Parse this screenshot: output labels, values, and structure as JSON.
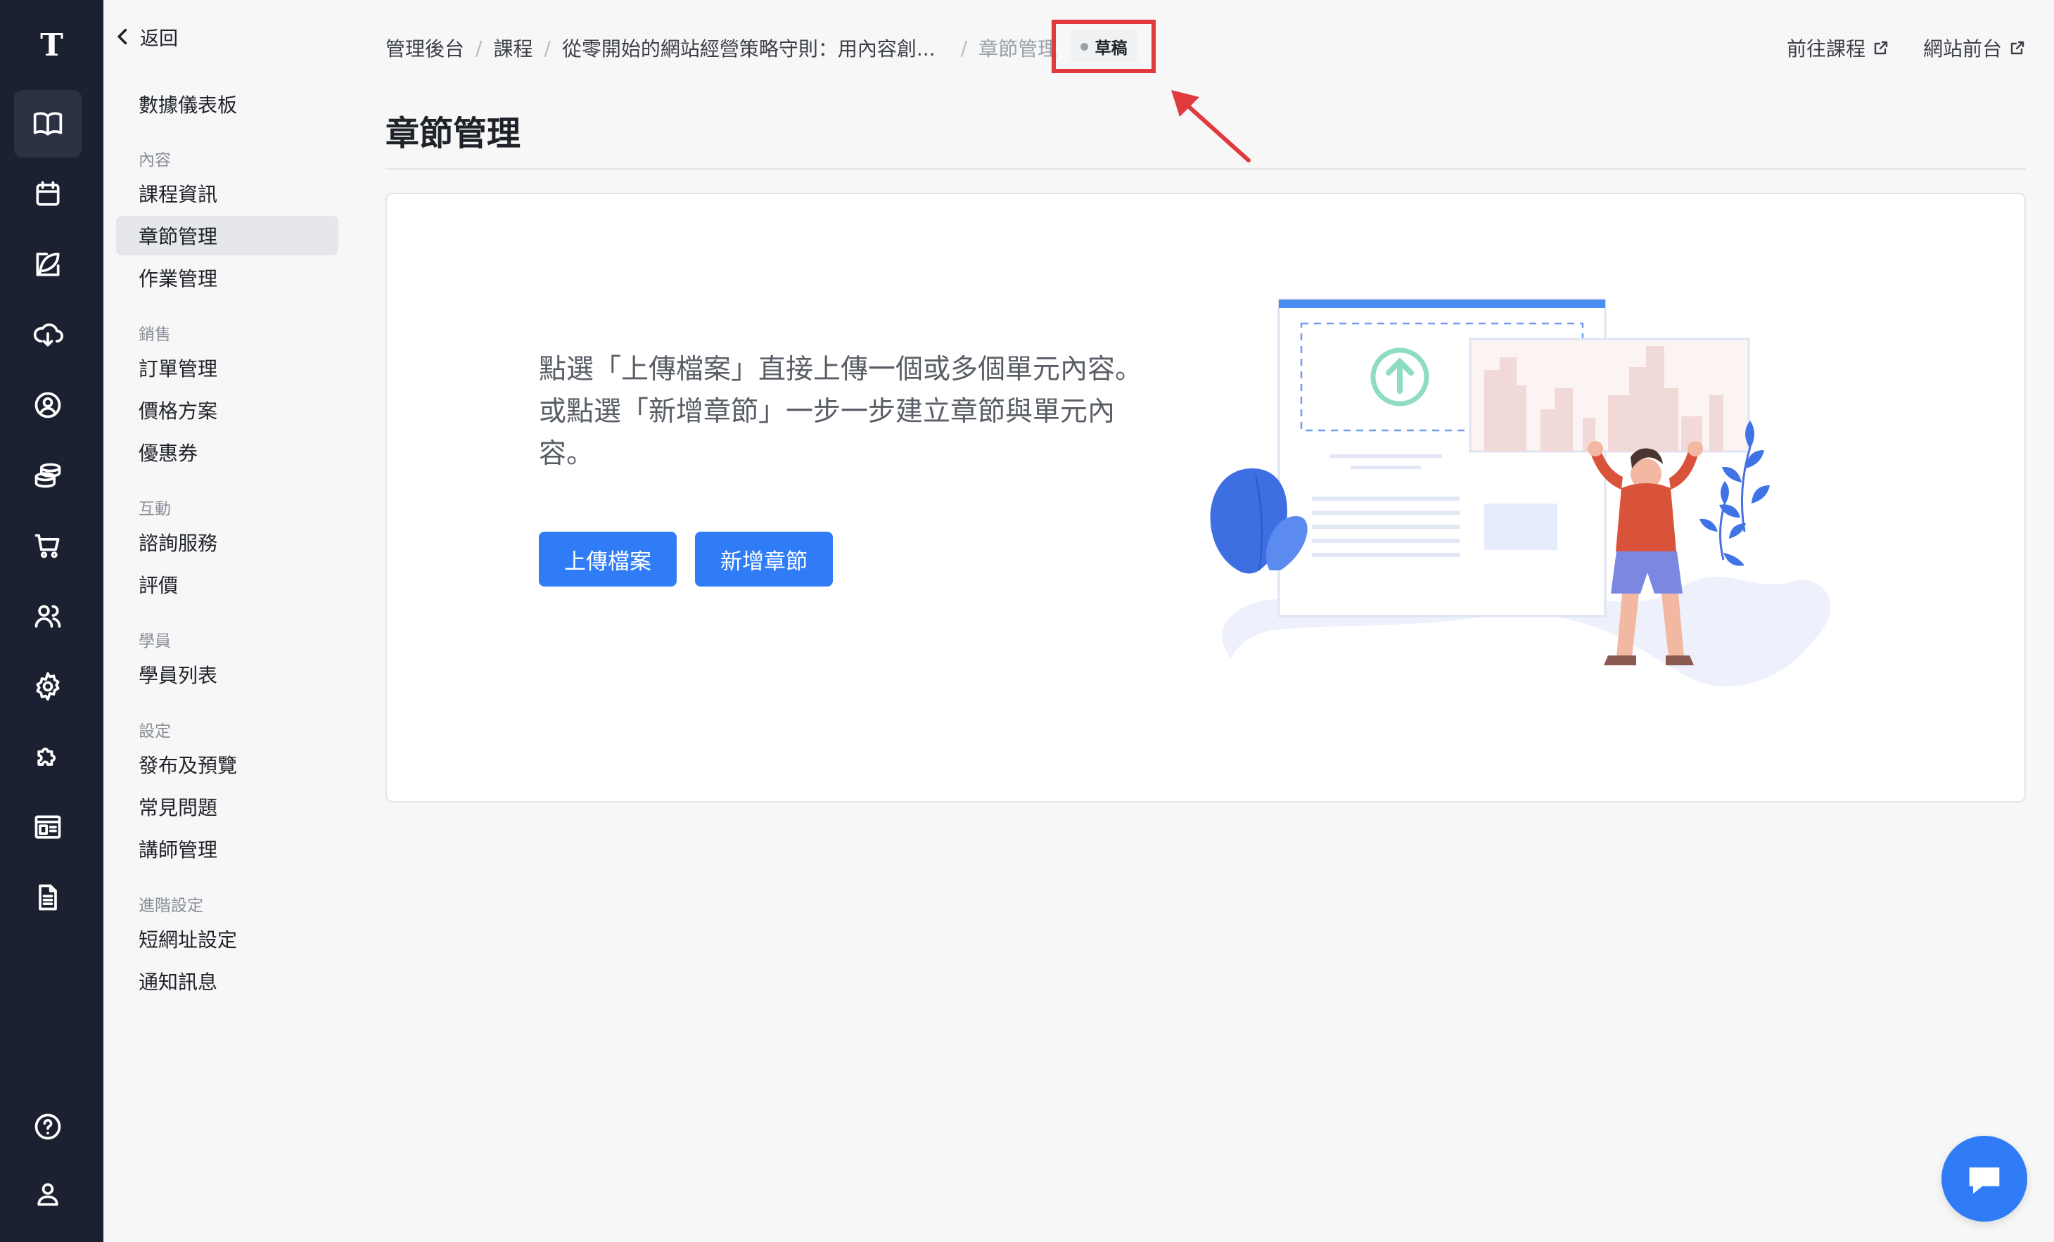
{
  "rail": {
    "logo": "T",
    "items": [
      {
        "icon": "book-icon",
        "active": true
      },
      {
        "icon": "calendar-icon",
        "active": false
      },
      {
        "icon": "feather-edit-icon",
        "active": false
      },
      {
        "icon": "cloud-download-icon",
        "active": false
      },
      {
        "icon": "user-circle-icon",
        "active": false
      },
      {
        "icon": "coins-stack-icon",
        "active": false
      },
      {
        "icon": "cart-icon",
        "active": false
      },
      {
        "icon": "users-icon",
        "active": false
      },
      {
        "icon": "gear-icon",
        "active": false
      },
      {
        "icon": "puzzle-icon",
        "active": false
      },
      {
        "icon": "layout-icon",
        "active": false
      },
      {
        "icon": "document-icon",
        "active": false
      }
    ],
    "bottom_items": [
      {
        "icon": "help-icon"
      },
      {
        "icon": "profile-icon"
      }
    ]
  },
  "sidebar": {
    "back_label": "返回",
    "dashboard": "數據儀表板",
    "sections": [
      {
        "heading": "內容",
        "items": [
          "課程資訊",
          "章節管理",
          "作業管理"
        ]
      },
      {
        "heading": "銷售",
        "items": [
          "訂單管理",
          "價格方案",
          "優惠券"
        ]
      },
      {
        "heading": "互動",
        "items": [
          "諮詢服務",
          "評價"
        ]
      },
      {
        "heading": "學員",
        "items": [
          "學員列表"
        ]
      },
      {
        "heading": "設定",
        "items": [
          "發布及預覽",
          "常見問題",
          "講師管理"
        ]
      },
      {
        "heading": "進階設定",
        "items": [
          "短網址設定",
          "通知訊息"
        ]
      }
    ],
    "active_item": "章節管理"
  },
  "header": {
    "breadcrumb": [
      "管理後台",
      "課程",
      "從零開始的網站經營策略守則：用內容創...",
      "章節管理"
    ],
    "status_badge": "草稿",
    "links": [
      "前往課程",
      "網站前台"
    ]
  },
  "main": {
    "title": "章節管理",
    "empty_text": "點選「上傳檔案」直接上傳一個或多個單元內容。或點選「新增章節」一步一步建立章節與單元內容。",
    "upload_button": "上傳檔案",
    "add_chapter_button": "新增章節"
  },
  "colors": {
    "rail_bg": "#1b2130",
    "primary": "#2f7cf6",
    "annotation": "#e03a3e"
  }
}
